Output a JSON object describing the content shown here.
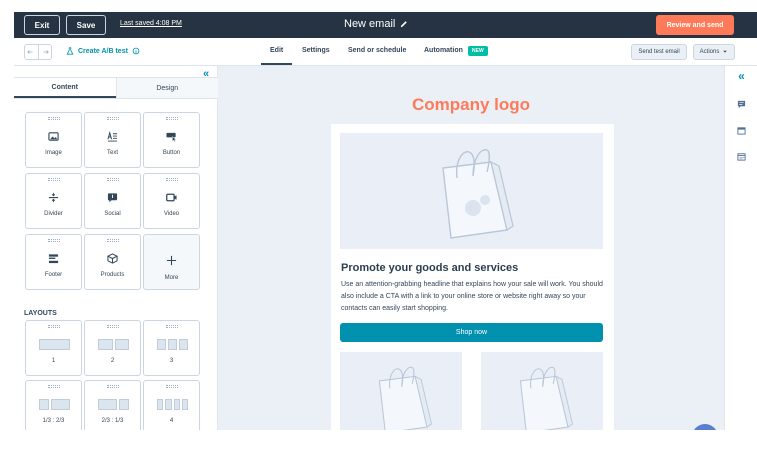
{
  "topbar": {
    "exit_label": "Exit",
    "save_label": "Save",
    "last_saved": "Last saved 4:08 PM",
    "email_name": "New email",
    "review_label": "Review and send"
  },
  "toolbar": {
    "ab_test_label": "Create A/B test",
    "tabs": [
      "Edit",
      "Settings",
      "Send or schedule",
      "Automation"
    ],
    "new_badge": "NEW",
    "send_test_label": "Send test email",
    "actions_label": "Actions"
  },
  "sidebar": {
    "collapse_glyph": "«",
    "tabs": [
      "Content",
      "Design"
    ],
    "modules": [
      {
        "label": "Image",
        "icon": "image-icon"
      },
      {
        "label": "Text",
        "icon": "text-icon"
      },
      {
        "label": "Button",
        "icon": "button-icon"
      },
      {
        "label": "Divider",
        "icon": "divider-icon"
      },
      {
        "label": "Social",
        "icon": "social-icon"
      },
      {
        "label": "Video",
        "icon": "video-icon"
      },
      {
        "label": "Footer",
        "icon": "footer-icon"
      },
      {
        "label": "Products",
        "icon": "products-icon"
      },
      {
        "label": "More",
        "icon": "plus-icon"
      }
    ],
    "layouts_title": "LAYOUTS",
    "layouts": [
      "1",
      "2",
      "3",
      "1/3 : 2/3",
      "2/3 : 1/3",
      "4"
    ]
  },
  "email": {
    "logo_text": "Company logo",
    "headline": "Promote your goods and services",
    "body": "Use an attention-grabbing headline that explains how your sale will work. You should also include a CTA with a link to your online store or website right away so your contacts can easily start shopping.",
    "cta_label": "Shop now"
  },
  "rail": {
    "collapse_glyph": "«",
    "icons": [
      "comment-icon",
      "calendar-icon",
      "schedule-icon"
    ]
  },
  "colors": {
    "topbar": "#253342",
    "accent_orange": "#ff7a59",
    "teal": "#0091ae",
    "new_badge": "#00bda5"
  }
}
